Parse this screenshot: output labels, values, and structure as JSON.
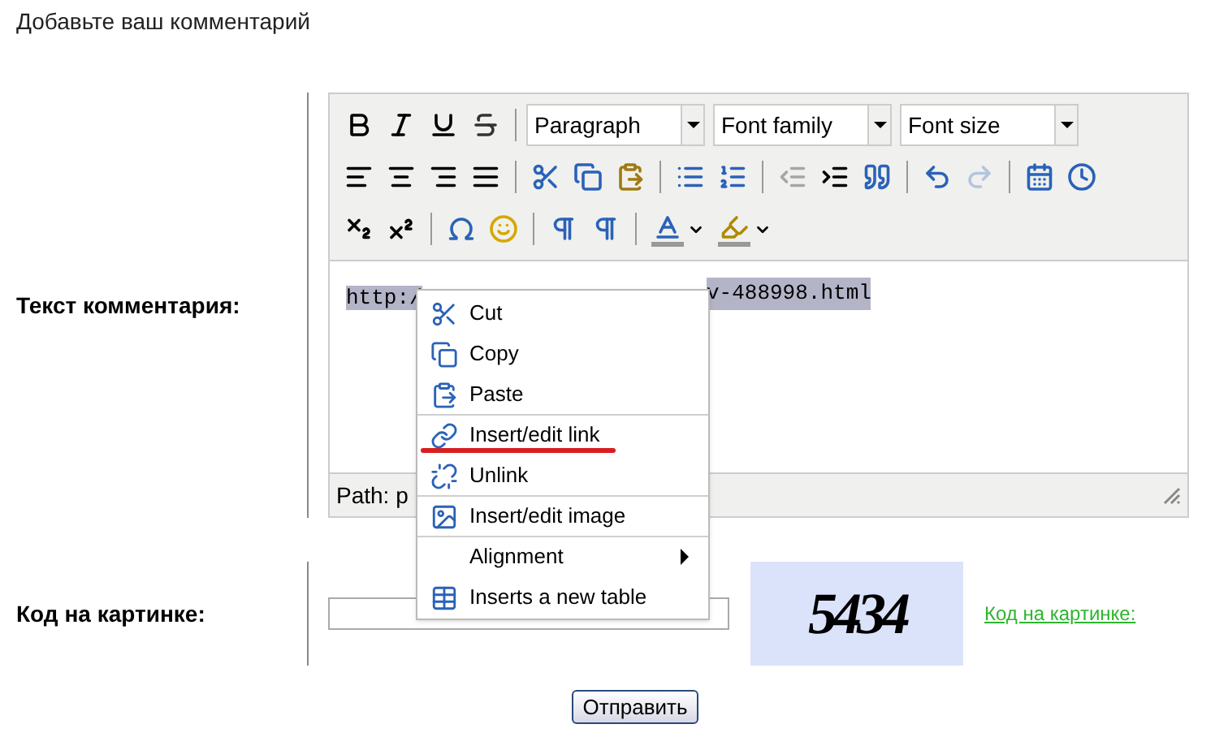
{
  "heading": "Добавьте ваш комментарий",
  "comment_label": "Текст комментария:",
  "toolbar": {
    "rows": [
      [
        {
          "kind": "button",
          "disabled": false
        },
        {
          "kind": "button",
          "disabled": false
        },
        {
          "kind": "button",
          "disabled": false
        },
        {
          "kind": "button",
          "disabled": false
        },
        {
          "kind": "separator"
        },
        {
          "kind": "select",
          "label": "Paragraph"
        },
        {
          "kind": "select",
          "label": "Font family"
        },
        {
          "kind": "select",
          "label": "Font size"
        }
      ],
      [
        {
          "kind": "button",
          "disabled": false
        },
        {
          "kind": "button",
          "disabled": false
        },
        {
          "kind": "button",
          "disabled": false
        },
        {
          "kind": "button",
          "disabled": false
        },
        {
          "kind": "separator"
        },
        {
          "kind": "button",
          "disabled": false
        },
        {
          "kind": "button",
          "disabled": false
        },
        {
          "kind": "button",
          "disabled": false
        },
        {
          "kind": "separator"
        },
        {
          "kind": "button",
          "disabled": false
        },
        {
          "kind": "button",
          "disabled": false
        },
        {
          "kind": "separator"
        },
        {
          "kind": "button",
          "disabled": true
        },
        {
          "kind": "button",
          "disabled": false
        },
        {
          "kind": "button",
          "disabled": false
        },
        {
          "kind": "separator"
        },
        {
          "kind": "button",
          "disabled": false
        },
        {
          "kind": "button",
          "disabled": true
        },
        {
          "kind": "separator"
        },
        {
          "kind": "button",
          "disabled": false
        },
        {
          "kind": "button",
          "disabled": false
        }
      ],
      [
        {
          "kind": "button",
          "disabled": false
        },
        {
          "kind": "button",
          "disabled": false
        },
        {
          "kind": "separator"
        },
        {
          "kind": "button",
          "disabled": false
        },
        {
          "kind": "button",
          "disabled": false
        },
        {
          "kind": "separator"
        },
        {
          "kind": "button",
          "disabled": false
        },
        {
          "kind": "button",
          "disabled": false
        },
        {
          "kind": "separator"
        },
        {
          "kind": "split",
          "disabled": false
        },
        {
          "kind": "split",
          "disabled": false
        }
      ]
    ]
  },
  "editor": {
    "text_start": "http:/",
    "text_end": "v-488998.html",
    "selected": true,
    "path": "Path: p"
  },
  "context_menu": [
    {
      "label": "Cut",
      "separator_before": false,
      "submenu": false,
      "underlined": false
    },
    {
      "label": "Copy",
      "separator_before": false,
      "submenu": false,
      "underlined": false
    },
    {
      "label": "Paste",
      "separator_before": false,
      "submenu": false,
      "underlined": false
    },
    {
      "label": "Insert/edit link",
      "separator_before": true,
      "submenu": false,
      "underlined": true
    },
    {
      "label": "Unlink",
      "separator_before": false,
      "submenu": false,
      "underlined": false
    },
    {
      "label": "Insert/edit image",
      "separator_before": true,
      "submenu": false,
      "underlined": false
    },
    {
      "label": "Alignment",
      "separator_before": true,
      "submenu": true,
      "underlined": false
    },
    {
      "label": "Inserts a new table",
      "separator_before": false,
      "submenu": false,
      "underlined": false
    }
  ],
  "captcha_label": "Код на картинке:",
  "captcha_code": "5434",
  "captcha_link": "Код на картинке:",
  "submit": "Отправить"
}
